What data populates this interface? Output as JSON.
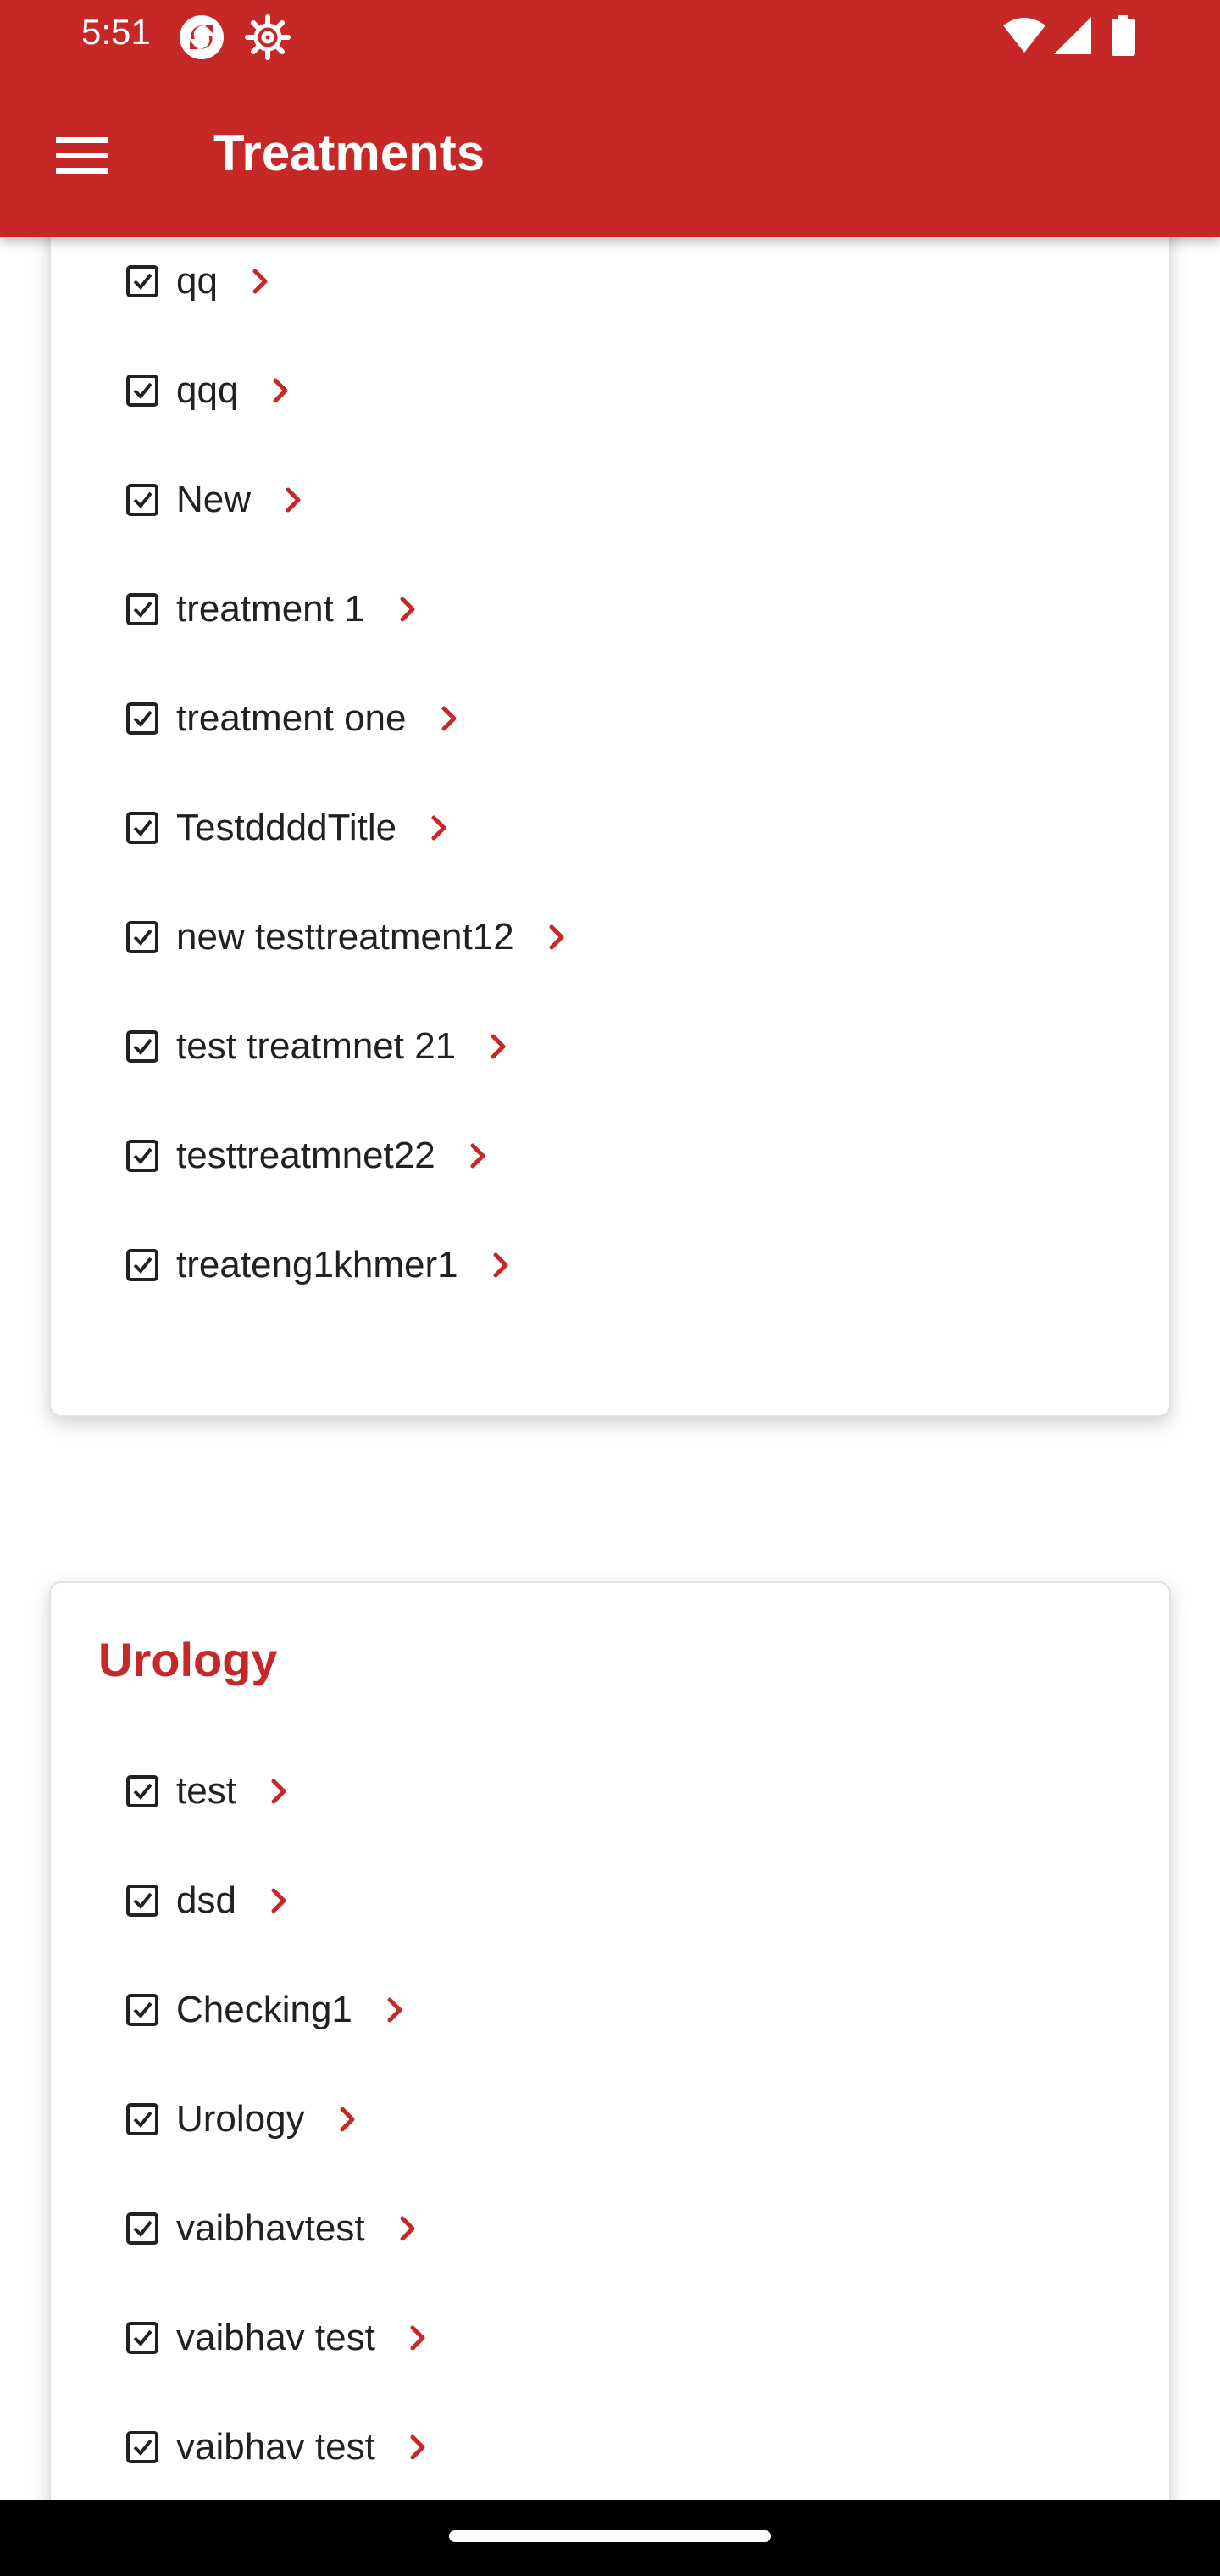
{
  "status_bar": {
    "time": "5:51"
  },
  "app_bar": {
    "title": "Treatments"
  },
  "card1": {
    "items": [
      {
        "label": "qq"
      },
      {
        "label": "qqq"
      },
      {
        "label": "New"
      },
      {
        "label": "treatment 1"
      },
      {
        "label": "treatment one"
      },
      {
        "label": "TestddddTitle"
      },
      {
        "label": "new testtreatment12"
      },
      {
        "label": "test treatmnet 21"
      },
      {
        "label": "testtreatmnet22"
      },
      {
        "label": "treateng1khmer1"
      }
    ]
  },
  "card2": {
    "title": "Urology",
    "items": [
      {
        "label": "test"
      },
      {
        "label": "dsd"
      },
      {
        "label": "Checking1"
      },
      {
        "label": "Urology"
      },
      {
        "label": "vaibhavtest"
      },
      {
        "label": "vaibhav test"
      },
      {
        "label": "vaibhav test"
      }
    ]
  },
  "colors": {
    "primary": "#c62828",
    "text": "#202124"
  },
  "icons": {
    "menu": "menu-icon",
    "checkbox": "checkbox-checked-icon",
    "chevron": "chevron-right-icon"
  }
}
